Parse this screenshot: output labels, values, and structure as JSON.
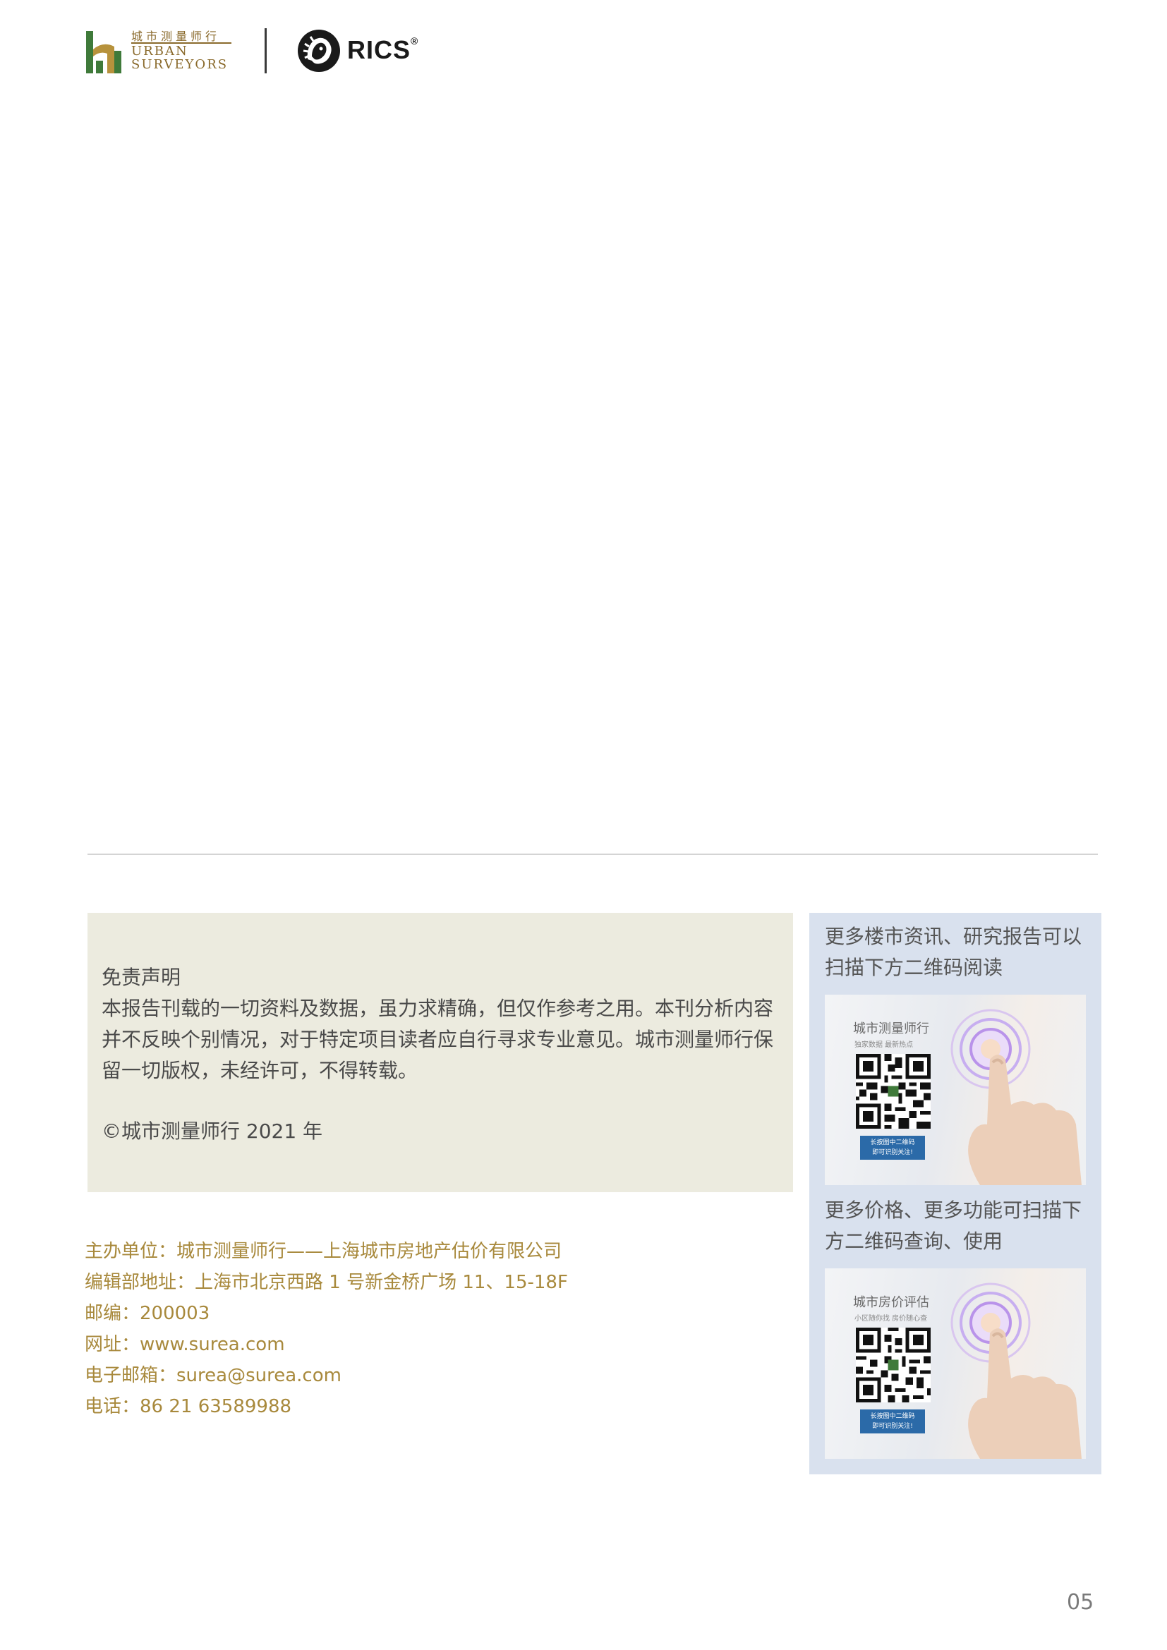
{
  "header": {
    "urban_surveyors": {
      "name_cn": "城市测量师行",
      "name_en_line1": "URBAN",
      "name_en_line2": "SURVEYORS"
    },
    "rics": {
      "wordmark": "RICS",
      "registered": "®"
    }
  },
  "disclaimer": {
    "title": "免责声明",
    "body": "本报告刊载的一切资料及数据，虽力求精确，但仅作参考之用。本刊分析内容并不反映个别情况，对于特定项目读者应自行寻求专业意见。城市测量师行保留一切版权，未经许可，不得转载。",
    "copyright": "©城市测量师行 2021 年"
  },
  "contact": {
    "organizer": "主办单位：城市测量师行——上海城市房地产估价有限公司",
    "address": "编辑部地址：上海市北京西路 1 号新金桥广场 11、15-18F",
    "postcode": "邮编：200003",
    "website": "网址：www.surea.com",
    "email": "电子邮箱：surea@surea.com",
    "phone": "电话：86 21 63589988"
  },
  "qr_panel": {
    "card1": {
      "caption": "更多楼市资讯、研究报告可以扫描下方二维码阅读",
      "title": "城市测量师行",
      "subtitle": "独家数据  最新热点",
      "badge_line1": "长按图中二维码",
      "badge_line2": "即可识别关注!"
    },
    "card2": {
      "caption": "更多价格、更多功能可扫描下方二维码查询、使用",
      "title": "城市房价评估",
      "subtitle": "小区随你找  房价随心查",
      "badge_line1": "长按图中二维码",
      "badge_line2": "即可识别关注!"
    }
  },
  "page_number": "05",
  "colors": {
    "brand_gold": "#a8893c",
    "brand_green": "#3f7a3a",
    "disclaimer_bg": "#ecebdf",
    "qr_panel_bg": "#d9e1ee",
    "qr_badge_blue": "#2b6aa8"
  }
}
